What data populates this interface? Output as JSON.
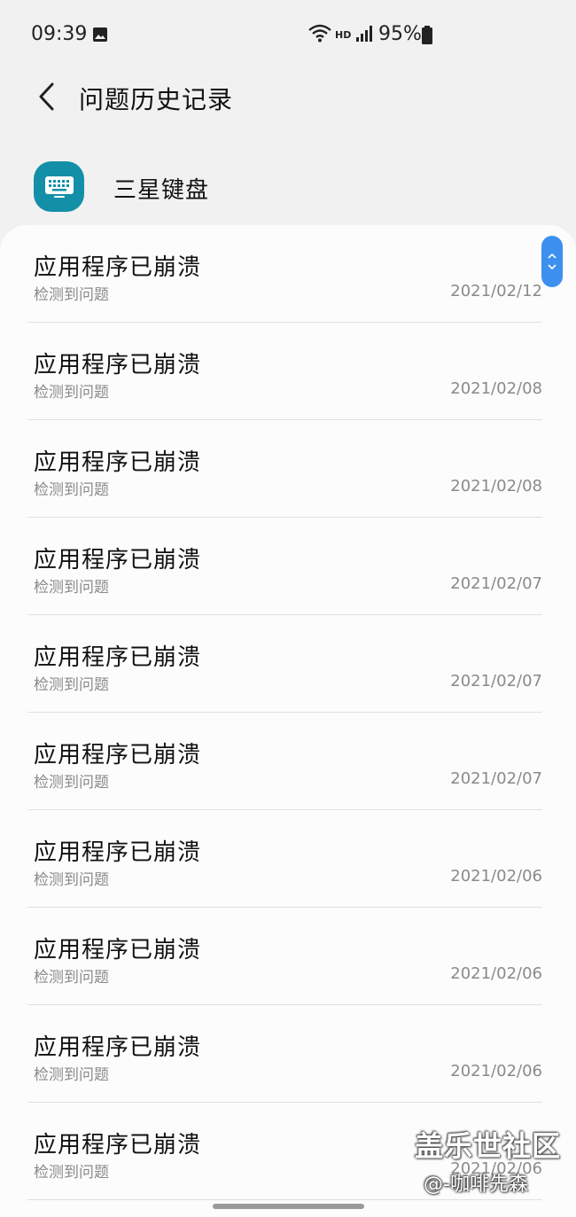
{
  "status_bar": {
    "time": "09:39",
    "hd": "HD",
    "battery": "95%",
    "icons": [
      "gallery-icon",
      "wifi-icon",
      "signal-icon",
      "battery-icon"
    ]
  },
  "header": {
    "title": "问题历史记录",
    "back_icon": "chevron-left-icon"
  },
  "app": {
    "name": "三星键盘",
    "icon": "keyboard-icon",
    "icon_color": "#148fa8"
  },
  "items": [
    {
      "title": "应用程序已崩溃",
      "subtitle": "检测到问题",
      "date": "2021/02/12"
    },
    {
      "title": "应用程序已崩溃",
      "subtitle": "检测到问题",
      "date": "2021/02/08"
    },
    {
      "title": "应用程序已崩溃",
      "subtitle": "检测到问题",
      "date": "2021/02/08"
    },
    {
      "title": "应用程序已崩溃",
      "subtitle": "检测到问题",
      "date": "2021/02/07"
    },
    {
      "title": "应用程序已崩溃",
      "subtitle": "检测到问题",
      "date": "2021/02/07"
    },
    {
      "title": "应用程序已崩溃",
      "subtitle": "检测到问题",
      "date": "2021/02/07"
    },
    {
      "title": "应用程序已崩溃",
      "subtitle": "检测到问题",
      "date": "2021/02/06"
    },
    {
      "title": "应用程序已崩溃",
      "subtitle": "检测到问题",
      "date": "2021/02/06"
    },
    {
      "title": "应用程序已崩溃",
      "subtitle": "检测到问题",
      "date": "2021/02/06"
    },
    {
      "title": "应用程序已崩溃",
      "subtitle": "检测到问题",
      "date": "2021/02/06"
    }
  ],
  "scroll": {
    "accent": "#3d90ee"
  },
  "watermark": {
    "title": "盖乐世社区",
    "author": "@-咖啡先森"
  }
}
